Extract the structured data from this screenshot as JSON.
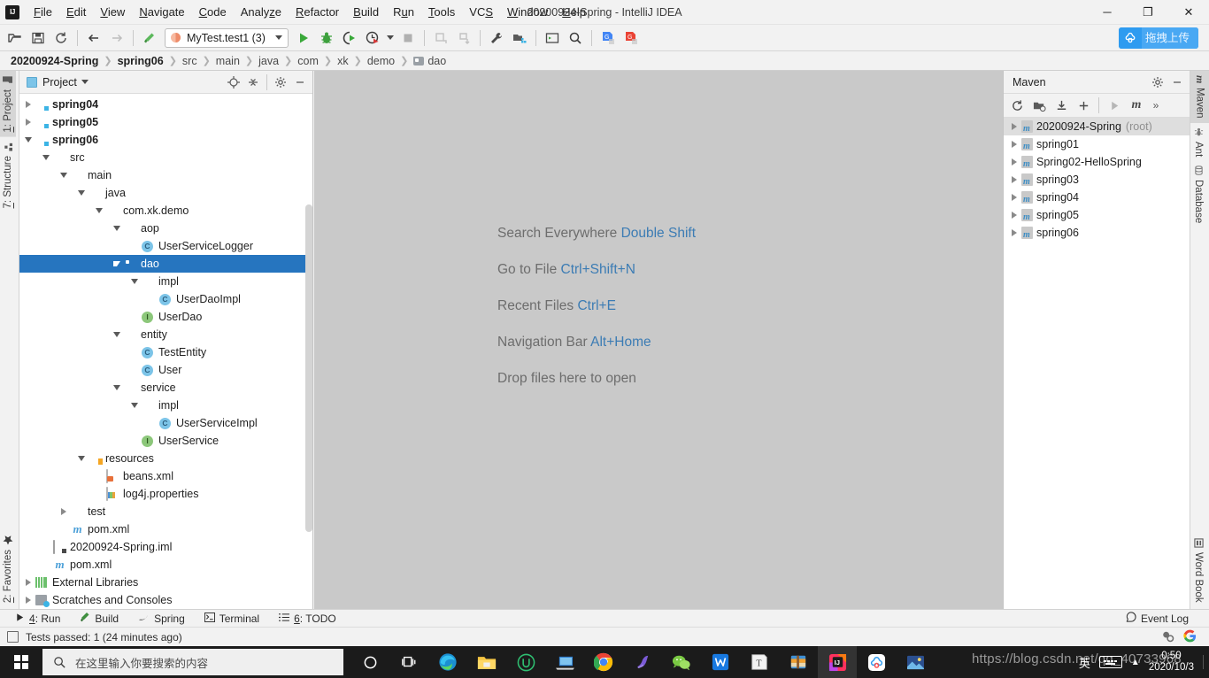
{
  "window": {
    "title": "20200924-Spring - IntelliJ IDEA",
    "minimize": "─",
    "maximize": "❐",
    "close": "✕"
  },
  "menubar": {
    "items": [
      {
        "label": "File"
      },
      {
        "label": "Edit"
      },
      {
        "label": "View"
      },
      {
        "label": "Navigate"
      },
      {
        "label": "Code"
      },
      {
        "label": "Analyze"
      },
      {
        "label": "Refactor"
      },
      {
        "label": "Build"
      },
      {
        "label": "Run"
      },
      {
        "label": "Tools"
      },
      {
        "label": "VCS"
      },
      {
        "label": "Window"
      },
      {
        "label": "Help"
      }
    ]
  },
  "toolbar": {
    "run_config": "MyTest.test1 (3)",
    "upload_label": "拖拽上传",
    "icons": [
      "open-folder-icon",
      "save-icon",
      "sync-icon",
      "back-arrow-icon",
      "forward-arrow-icon",
      "build-hammer-icon",
      "run-icon",
      "debug-icon",
      "run-with-coverage-icon",
      "profile-icon",
      "stop-icon",
      "update-project-icon",
      "commit-icon",
      "settings-wrench-icon",
      "project-structure-icon",
      "terminal-icon",
      "search-icon",
      "translate-blue-icon",
      "translate-red-icon"
    ]
  },
  "breadcrumb": {
    "items": [
      {
        "label": "20200924-Spring",
        "bold": true,
        "folder": false
      },
      {
        "label": "spring06",
        "bold": true,
        "folder": false
      },
      {
        "label": "src",
        "bold": false,
        "folder": false
      },
      {
        "label": "main",
        "bold": false,
        "folder": false
      },
      {
        "label": "java",
        "bold": false,
        "folder": false
      },
      {
        "label": "com",
        "bold": false,
        "folder": false
      },
      {
        "label": "xk",
        "bold": false,
        "folder": false
      },
      {
        "label": "demo",
        "bold": false,
        "folder": false
      },
      {
        "label": "dao",
        "bold": false,
        "folder": true
      }
    ],
    "separator": "❯"
  },
  "left_stripe": {
    "top": [
      {
        "label": "1: Project",
        "active": true,
        "icon": "project-icon"
      },
      {
        "label": "7: Structure",
        "active": false,
        "icon": "structure-icon"
      }
    ],
    "bottom": [
      {
        "label": "2: Favorites",
        "active": false,
        "icon": "star-icon"
      }
    ]
  },
  "right_stripe": {
    "top": [
      {
        "label": "Maven",
        "active": true,
        "icon": "maven-icon"
      },
      {
        "label": "Ant",
        "active": false,
        "icon": "ant-icon"
      },
      {
        "label": "Database",
        "active": false,
        "icon": "database-icon"
      }
    ],
    "bottom": [
      {
        "label": "Word Book",
        "active": false,
        "icon": "book-icon"
      }
    ]
  },
  "project_panel": {
    "title": "Project",
    "tools": [
      "locate-target-icon",
      "collapse-all-icon",
      "gear-icon",
      "hide-icon"
    ],
    "tree": [
      {
        "indent": 1,
        "arrow": "right",
        "icon": "module-icon",
        "label": "spring04",
        "bold": true,
        "selected": false
      },
      {
        "indent": 1,
        "arrow": "right",
        "icon": "module-icon",
        "label": "spring05",
        "bold": true,
        "selected": false
      },
      {
        "indent": 1,
        "arrow": "down",
        "icon": "module-icon",
        "label": "spring06",
        "bold": true,
        "selected": false
      },
      {
        "indent": 2,
        "arrow": "down",
        "icon": "folder-icon",
        "label": "src",
        "bold": false,
        "selected": false
      },
      {
        "indent": 3,
        "arrow": "down",
        "icon": "folder-icon",
        "label": "main",
        "bold": false,
        "selected": false
      },
      {
        "indent": 4,
        "arrow": "down",
        "icon": "source-root-icon",
        "label": "java",
        "bold": false,
        "selected": false
      },
      {
        "indent": 5,
        "arrow": "down",
        "icon": "package-icon",
        "label": "com.xk.demo",
        "bold": false,
        "selected": false
      },
      {
        "indent": 6,
        "arrow": "down",
        "icon": "package-icon",
        "label": "aop",
        "bold": false,
        "selected": false
      },
      {
        "indent": 7,
        "arrow": "none",
        "icon": "class-icon",
        "label": "UserServiceLogger",
        "bold": false,
        "selected": false
      },
      {
        "indent": 6,
        "arrow": "down",
        "icon": "package-icon",
        "label": "dao",
        "bold": false,
        "selected": true
      },
      {
        "indent": 7,
        "arrow": "down",
        "icon": "package-icon",
        "label": "impl",
        "bold": false,
        "selected": false
      },
      {
        "indent": 8,
        "arrow": "none",
        "icon": "class-icon",
        "label": "UserDaoImpl",
        "bold": false,
        "selected": false
      },
      {
        "indent": 7,
        "arrow": "none",
        "icon": "interface-icon",
        "label": "UserDao",
        "bold": false,
        "selected": false
      },
      {
        "indent": 6,
        "arrow": "down",
        "icon": "package-icon",
        "label": "entity",
        "bold": false,
        "selected": false
      },
      {
        "indent": 7,
        "arrow": "none",
        "icon": "class-icon",
        "label": "TestEntity",
        "bold": false,
        "selected": false
      },
      {
        "indent": 7,
        "arrow": "none",
        "icon": "class-icon",
        "label": "User",
        "bold": false,
        "selected": false
      },
      {
        "indent": 6,
        "arrow": "down",
        "icon": "package-icon",
        "label": "service",
        "bold": false,
        "selected": false
      },
      {
        "indent": 7,
        "arrow": "down",
        "icon": "package-icon",
        "label": "impl",
        "bold": false,
        "selected": false
      },
      {
        "indent": 8,
        "arrow": "none",
        "icon": "class-icon",
        "label": "UserServiceImpl",
        "bold": false,
        "selected": false
      },
      {
        "indent": 7,
        "arrow": "none",
        "icon": "interface-icon",
        "label": "UserService",
        "bold": false,
        "selected": false
      },
      {
        "indent": 4,
        "arrow": "down",
        "icon": "resource-root-icon",
        "label": "resources",
        "bold": false,
        "selected": false
      },
      {
        "indent": 5,
        "arrow": "none",
        "icon": "xml-file-icon",
        "label": "beans.xml",
        "bold": false,
        "selected": false
      },
      {
        "indent": 5,
        "arrow": "none",
        "icon": "properties-file-icon",
        "label": "log4j.properties",
        "bold": false,
        "selected": false
      },
      {
        "indent": 3,
        "arrow": "right",
        "icon": "folder-icon",
        "label": "test",
        "bold": false,
        "selected": false
      },
      {
        "indent": 3,
        "arrow": "none",
        "icon": "maven-pom-icon",
        "label": "pom.xml",
        "bold": false,
        "selected": false
      },
      {
        "indent": 2,
        "arrow": "none",
        "icon": "iml-file-icon",
        "label": "20200924-Spring.iml",
        "bold": false,
        "selected": false
      },
      {
        "indent": 2,
        "arrow": "none",
        "icon": "maven-pom-icon",
        "label": "pom.xml",
        "bold": false,
        "selected": false
      },
      {
        "indent": 1,
        "arrow": "right",
        "icon": "library-icon",
        "label": "External Libraries",
        "bold": false,
        "selected": false
      },
      {
        "indent": 1,
        "arrow": "right",
        "icon": "scratches-icon",
        "label": "Scratches and Consoles",
        "bold": false,
        "selected": false
      }
    ]
  },
  "editor": {
    "hints": [
      {
        "text": "Search Everywhere ",
        "key": "Double Shift"
      },
      {
        "text": "Go to File ",
        "key": "Ctrl+Shift+N"
      },
      {
        "text": "Recent Files ",
        "key": "Ctrl+E"
      },
      {
        "text": "Navigation Bar ",
        "key": "Alt+Home"
      },
      {
        "text": "Drop files here to open",
        "key": ""
      }
    ]
  },
  "maven_panel": {
    "title": "Maven",
    "head_tools": [
      "gear-icon",
      "hide-icon"
    ],
    "toolbar_icons": [
      "reimport-icon",
      "generate-sources-icon",
      "download-sources-icon",
      "add-icon",
      "run-maven-build-icon",
      "execute-goal-icon",
      "more-icon"
    ],
    "more_label": "»",
    "projects": [
      {
        "label": "20200924-Spring",
        "suffix": "(root)",
        "selected": true
      },
      {
        "label": "spring01",
        "suffix": "",
        "selected": false
      },
      {
        "label": "Spring02-HelloSpring",
        "suffix": "",
        "selected": false
      },
      {
        "label": "spring03",
        "suffix": "",
        "selected": false
      },
      {
        "label": "spring04",
        "suffix": "",
        "selected": false
      },
      {
        "label": "spring05",
        "suffix": "",
        "selected": false
      },
      {
        "label": "spring06",
        "suffix": "",
        "selected": false
      }
    ]
  },
  "bottom_bar": {
    "tabs": [
      {
        "label": "4: Run",
        "icon": "run-icon"
      },
      {
        "label": "Build",
        "icon": "build-hammer-icon"
      },
      {
        "label": "Spring",
        "icon": "spring-leaf-icon"
      },
      {
        "label": "Terminal",
        "icon": "terminal-icon"
      },
      {
        "label": "6: TODO",
        "icon": "todo-list-icon"
      }
    ],
    "event_log": "Event Log"
  },
  "status_bar": {
    "message": "Tests passed: 1 (24 minutes ago)",
    "right_icons": [
      "background-tasks-icon",
      "google-icon"
    ]
  },
  "taskbar": {
    "search_placeholder": "在这里输入你要搜索的内容",
    "apps": [
      {
        "name": "cortana-icon"
      },
      {
        "name": "task-view-icon"
      },
      {
        "name": "edge-icon"
      },
      {
        "name": "file-explorer-icon"
      },
      {
        "name": "utools-icon"
      },
      {
        "name": "remote-desktop-icon"
      },
      {
        "name": "chrome-icon"
      },
      {
        "name": "navicat-icon"
      },
      {
        "name": "wechat-icon"
      },
      {
        "name": "wps-icon"
      },
      {
        "name": "typora-icon"
      },
      {
        "name": "winrar-icon"
      },
      {
        "name": "intellij-idea-icon",
        "active": true
      },
      {
        "name": "baidu-netdisk-icon"
      },
      {
        "name": "photos-icon"
      }
    ],
    "time": "0:50",
    "date": "2020/10/3",
    "ime_label": "英"
  },
  "watermark": {
    "text": "https://blog.csdn.net/qq_40733968"
  },
  "colors": {
    "accent": "#2675bf",
    "link": "#3c7cb4",
    "editor_bg": "#c9c9c9",
    "chrome_bg": "#f2f2f2",
    "upload_blue": "#2e9bf0"
  }
}
